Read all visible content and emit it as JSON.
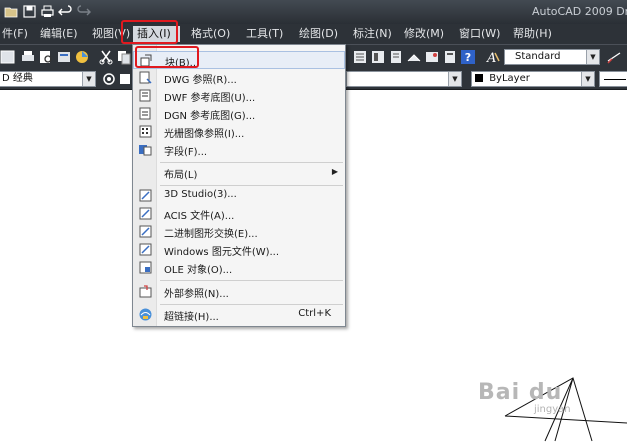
{
  "app": {
    "title": "AutoCAD 2009  Draw"
  },
  "menubar": {
    "items": [
      {
        "label": "件(F)"
      },
      {
        "label": "编辑(E)"
      },
      {
        "label": "视图(V)"
      },
      {
        "label": "插入(I)"
      },
      {
        "label": "格式(O)"
      },
      {
        "label": "工具(T)"
      },
      {
        "label": "绘图(D)"
      },
      {
        "label": "标注(N)"
      },
      {
        "label": "修改(M)"
      },
      {
        "label": "窗口(W)"
      },
      {
        "label": "帮助(H)"
      }
    ],
    "active_item": "插入(I)"
  },
  "toolbar": {
    "workspace_value": "D 经典",
    "text_style_value": "Standard",
    "layer_value": "ByLayer"
  },
  "insert_menu": {
    "items": [
      {
        "label": "块(B)...",
        "icon": "block-icon"
      },
      {
        "label": "DWG 参照(R)...",
        "icon": "dwg-ref-icon"
      },
      {
        "label": "DWF 参考底图(U)...",
        "icon": "dwf-underlay-icon"
      },
      {
        "label": "DGN 参考底图(G)...",
        "icon": "dgn-underlay-icon"
      },
      {
        "label": "光栅图像参照(I)...",
        "icon": "raster-image-icon"
      },
      {
        "label": "字段(F)...",
        "icon": "field-icon"
      },
      {
        "label": "布局(L)",
        "icon": ""
      },
      {
        "label": "3D Studio(3)...",
        "icon": "3dstudio-icon"
      },
      {
        "label": "ACIS 文件(A)...",
        "icon": "acis-icon"
      },
      {
        "label": "二进制图形交换(E)...",
        "icon": "dxb-icon"
      },
      {
        "label": "Windows 图元文件(W)...",
        "icon": "wmf-icon"
      },
      {
        "label": "OLE 对象(O)...",
        "icon": "ole-icon"
      },
      {
        "label": "外部参照(N)...",
        "icon": "xref-icon"
      },
      {
        "label": "超链接(H)...",
        "icon": "hyperlink-icon"
      }
    ],
    "hyperlink_shortcut": "Ctrl+K",
    "highlighted_item": "块(B)..."
  },
  "watermark": {
    "text": "Bai du",
    "sub": "jingyan"
  },
  "colors": {
    "titlebar": "#2a2f35",
    "menubar": "#2d3238",
    "highlight_border": "#e0191f",
    "menu_bg": "#f5f5f5"
  }
}
